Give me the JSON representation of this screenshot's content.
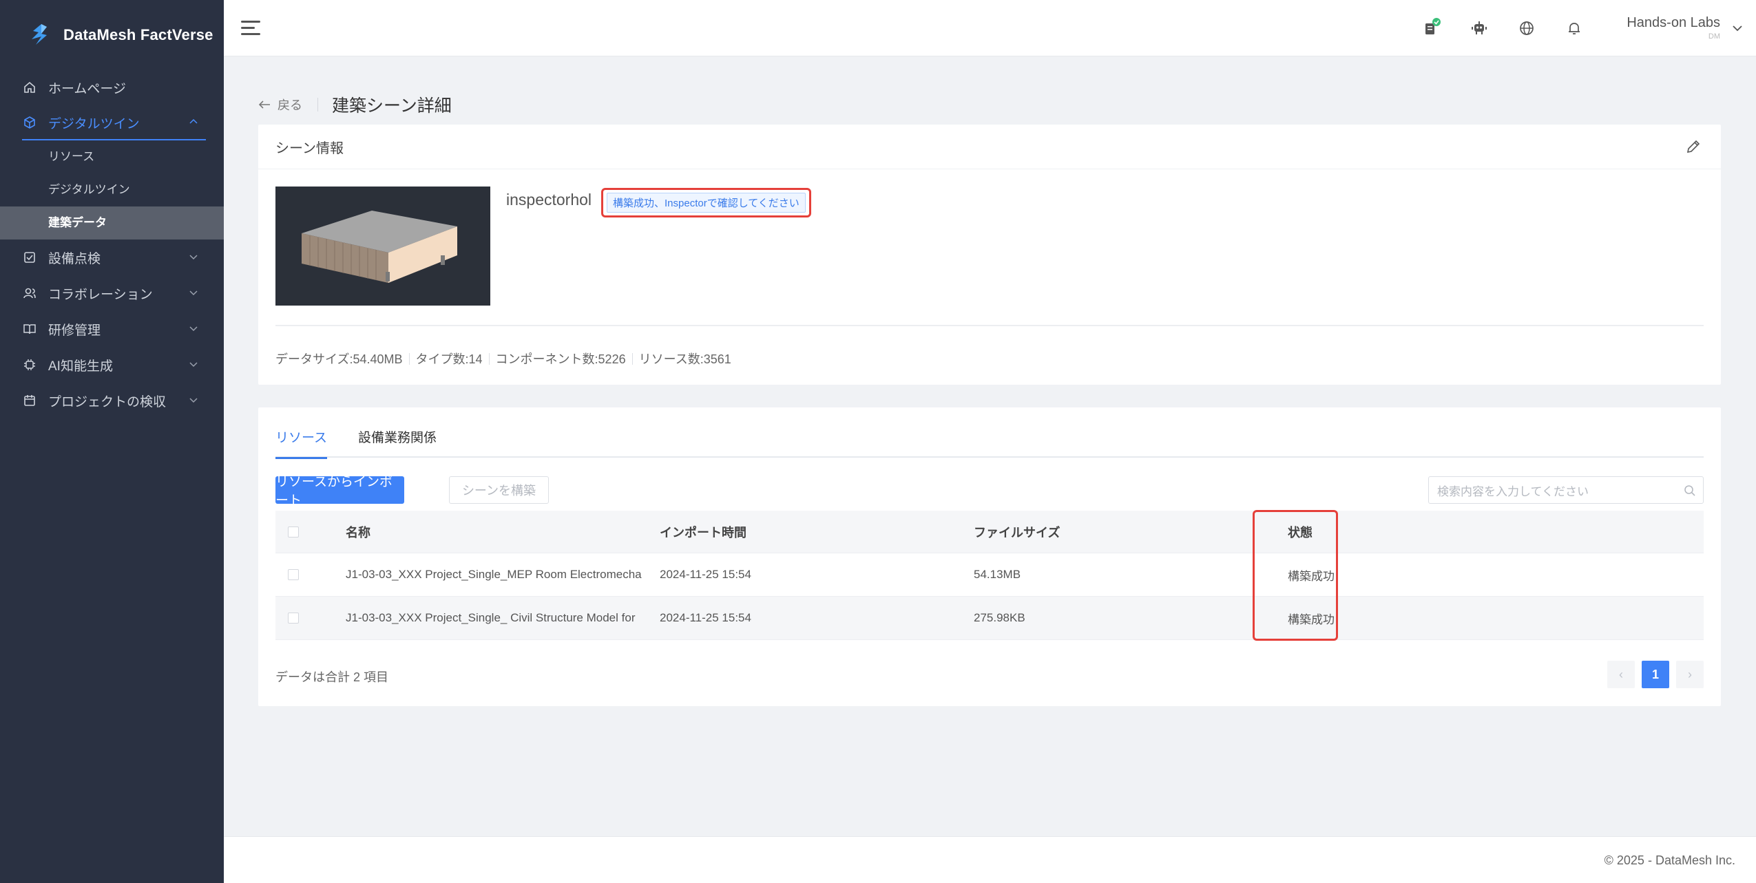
{
  "brand": {
    "name": "DataMesh FactVerse"
  },
  "sidebar": {
    "items": [
      {
        "label": "ホームページ",
        "icon": "home-icon",
        "expandable": false
      },
      {
        "label": "デジタルツイン",
        "icon": "cube-icon",
        "expandable": true,
        "active": true,
        "children": [
          {
            "label": "リソース"
          },
          {
            "label": "デジタルツイン"
          },
          {
            "label": "建築データ",
            "selected": true
          }
        ]
      },
      {
        "label": "設備点検",
        "icon": "checkbox-icon",
        "expandable": true
      },
      {
        "label": "コラボレーション",
        "icon": "users-icon",
        "expandable": true
      },
      {
        "label": "研修管理",
        "icon": "book-icon",
        "expandable": true
      },
      {
        "label": "AI知能生成",
        "icon": "ai-icon",
        "expandable": true
      },
      {
        "label": "プロジェクトの検収",
        "icon": "calendar-icon",
        "expandable": true
      }
    ]
  },
  "header": {
    "user_name": "Hands-on Labs",
    "user_sub": "DM",
    "icons": [
      "clipboard-check-icon",
      "robot-icon",
      "globe-icon",
      "bell-icon"
    ]
  },
  "breadcrumb": {
    "back_label": "戻る",
    "title": "建築シーン詳細"
  },
  "scene_info": {
    "section_title": "シーン情報",
    "name": "inspectorhol",
    "status_tag": "構築成功、Inspectorで確認してください",
    "stats": [
      "データサイズ:54.40MB",
      "タイプ数:14",
      "コンポーネント数:5226",
      "リソース数:3561"
    ]
  },
  "resources": {
    "tabs": [
      "リソース",
      "設備業務関係"
    ],
    "import_button": "リソースからインポート",
    "build_button": "シーンを構築",
    "search_placeholder": "検索内容を入力してください",
    "columns": {
      "name": "名称",
      "import_time": "インポート時間",
      "file_size": "ファイルサイズ",
      "status": "状態"
    },
    "rows": [
      {
        "name": "J1-03-03_XXX Project_Single_MEP Room Electromecha",
        "import_time": "2024-11-25 15:54",
        "file_size": "54.13MB",
        "status": "構築成功"
      },
      {
        "name": "J1-03-03_XXX Project_Single_ Civil Structure Model for",
        "import_time": "2024-11-25 15:54",
        "file_size": "275.98KB",
        "status": "構築成功"
      }
    ],
    "total_text": "データは合計 2 項目",
    "pagination": {
      "prev": "‹",
      "current": "1",
      "next": "›"
    }
  },
  "footer": {
    "copyright": "© 2025 - DataMesh Inc."
  },
  "colors": {
    "accent": "#3f82f7",
    "sidebar_bg": "#2a3142",
    "highlight": "#e5403a"
  }
}
